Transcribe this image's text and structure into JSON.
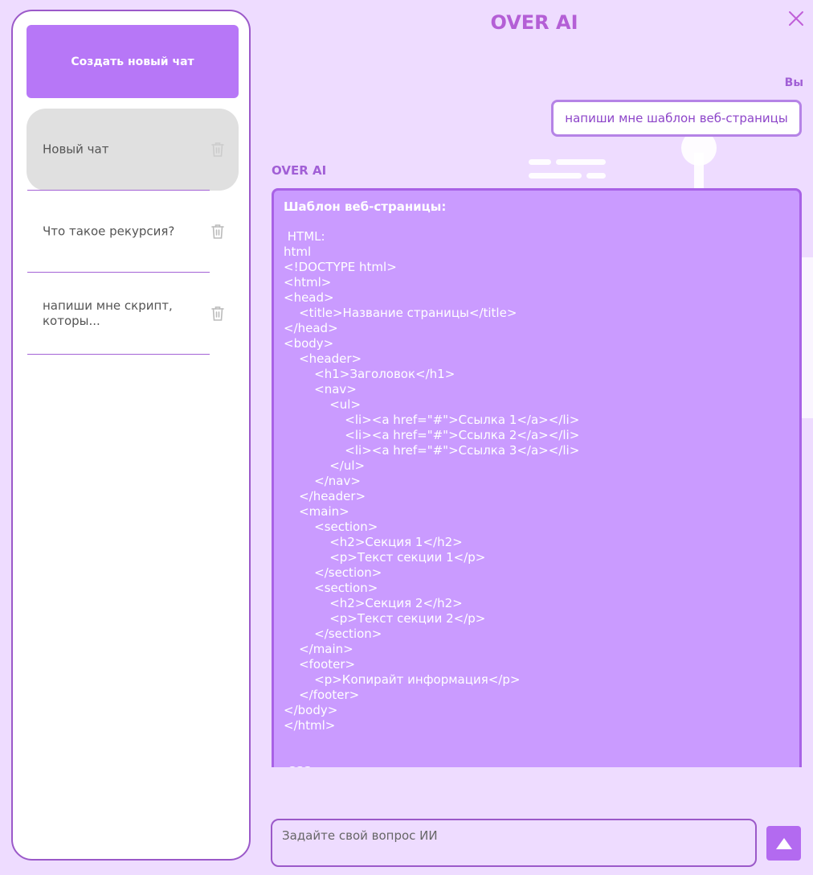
{
  "app": {
    "title": "OVER AI",
    "accent_color": "#b777f7",
    "background_color": "#eedcff"
  },
  "sidebar": {
    "new_chat_label": "Создать новый чат",
    "chats": [
      {
        "label": "Новый чат",
        "active": true,
        "icon": "trash-icon"
      },
      {
        "label": "Что такое рекурсия?",
        "active": false,
        "icon": "trash-icon"
      },
      {
        "label": "напиши мне скрипт,\nкоторы...",
        "active": false,
        "icon": "trash-icon"
      }
    ]
  },
  "messages": {
    "user_sender": "Вы",
    "user_text": "напиши мне шаблон веб-страницы",
    "ai_sender": "OVER AI",
    "ai_heading": "Шаблон веб-страницы:",
    "ai_body": " HTML:\nhtml\n<!DOCTYPE html>\n<html>\n<head>\n    <title>Название страницы</title>\n</head>\n<body>\n    <header>\n        <h1>Заголовок</h1>\n        <nav>\n            <ul>\n                <li><a href=\"#\">Ссылка 1</a></li>\n                <li><a href=\"#\">Ссылка 2</a></li>\n                <li><a href=\"#\">Ссылка 3</a></li>\n            </ul>\n        </nav>\n    </header>\n    <main>\n        <section>\n            <h2>Секция 1</h2>\n            <p>Текст секции 1</p>\n        </section>\n        <section>\n            <h2>Секция 2</h2>\n            <p>Текст секции 2</p>\n        </section>\n    </main>\n    <footer>\n        <p>Копирайт информация</p>\n    </footer>\n</body>\n</html>\n\n\n CSS:"
  },
  "input": {
    "placeholder": "Задайте свой вопрос ИИ"
  },
  "icons": {
    "close": "close-icon",
    "send": "arrow-up-icon",
    "delete": "trash-icon"
  }
}
